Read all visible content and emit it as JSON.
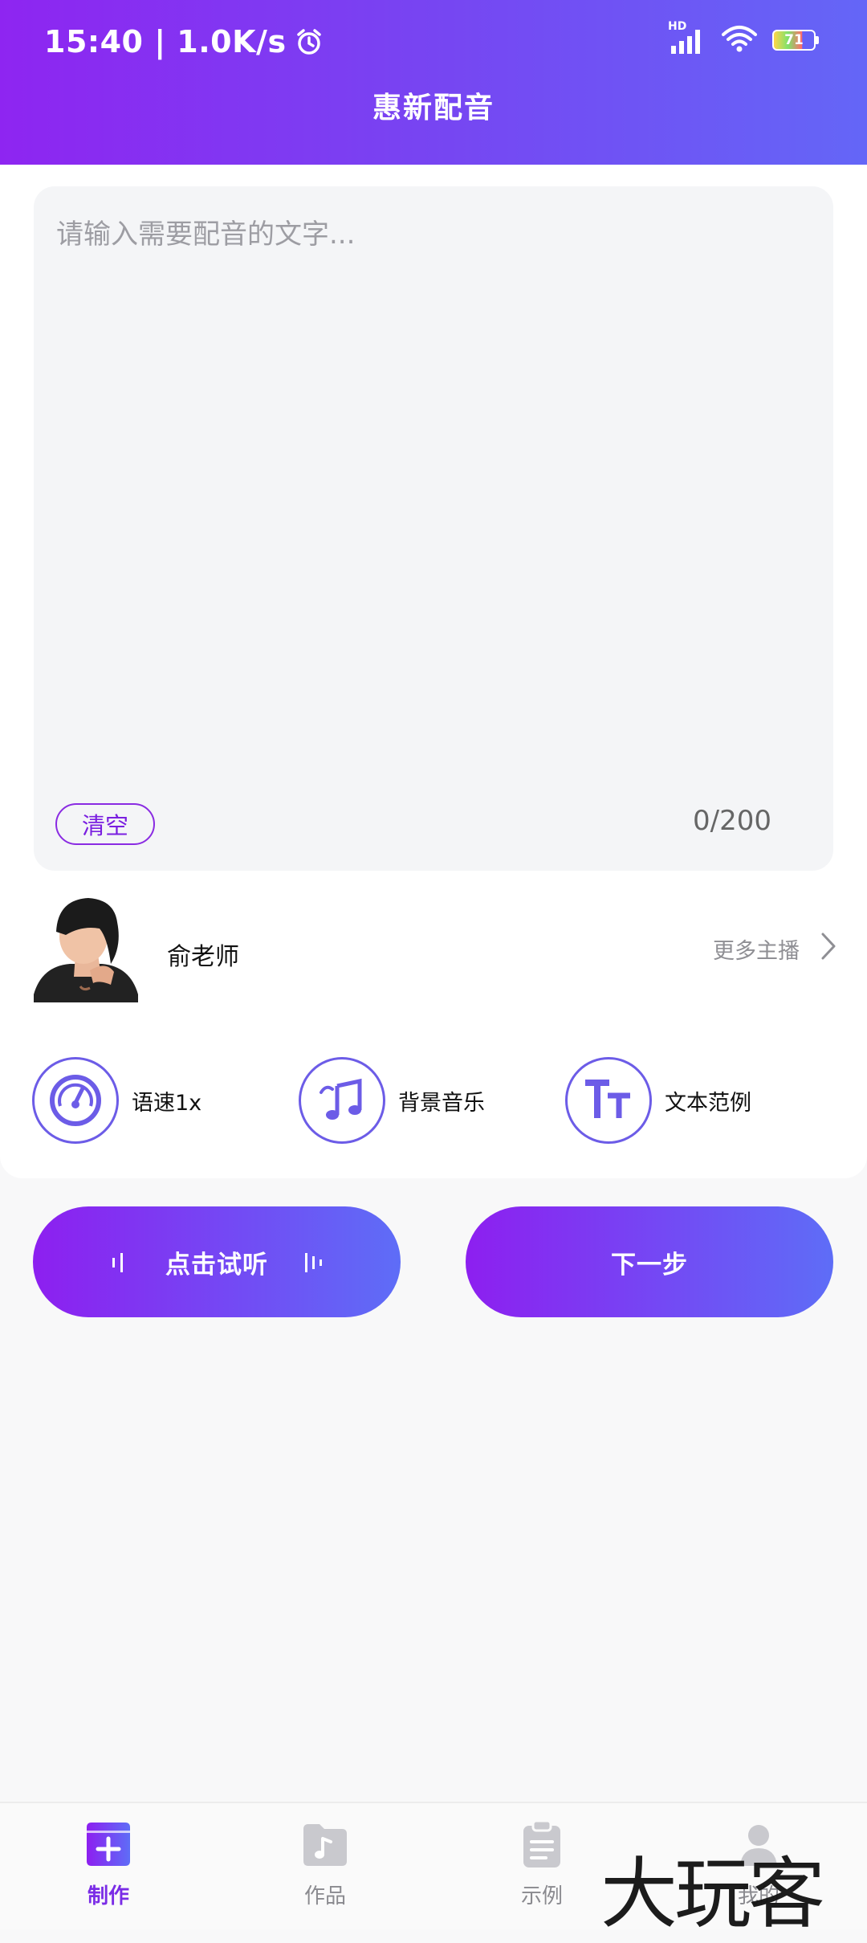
{
  "status_bar": {
    "time_speed": "15:40 | 1.0K/s",
    "network": "HD",
    "battery": "71"
  },
  "header": {
    "title": "惠新配音"
  },
  "editor": {
    "placeholder": "请输入需要配音的文字...",
    "clear_label": "清空",
    "counter": "0/200"
  },
  "anchor": {
    "name": "俞老师",
    "more_label": "更多主播"
  },
  "options": [
    {
      "label": "语速1x",
      "icon": "speedometer-icon"
    },
    {
      "label": "背景音乐",
      "icon": "music-note-icon"
    },
    {
      "label": "文本范例",
      "icon": "text-size-icon"
    }
  ],
  "actions": {
    "preview_label": "点击试听",
    "next_label": "下一步"
  },
  "nav": [
    {
      "label": "制作",
      "icon": "plus-folder-icon",
      "active": true
    },
    {
      "label": "作品",
      "icon": "music-folder-icon",
      "active": false
    },
    {
      "label": "示例",
      "icon": "clipboard-icon",
      "active": false
    },
    {
      "label": "我的",
      "icon": "person-icon",
      "active": false
    }
  ],
  "watermark": "大玩客",
  "colors": {
    "accent": "#7a2ce6",
    "gradient_start": "#8d1ff0",
    "gradient_end": "#5e6df7"
  }
}
